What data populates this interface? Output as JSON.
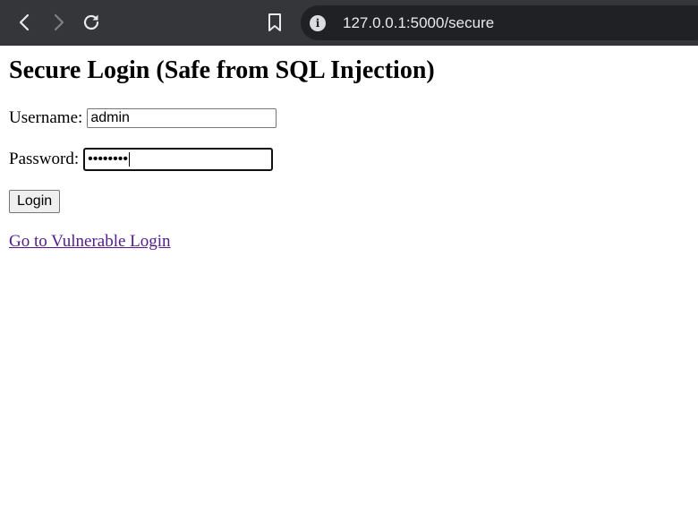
{
  "browser": {
    "url": "127.0.0.1:5000/secure",
    "colors": {
      "toolbar_bg": "#35363a",
      "omnibox_bg": "#202124",
      "icon": "#e8eaed",
      "icon_disabled": "#7f8084"
    },
    "icons": {
      "back": "back-arrow-icon",
      "forward": "forward-arrow-icon",
      "reload": "reload-icon",
      "bookmark": "bookmark-icon",
      "site_info": "info-icon"
    }
  },
  "page": {
    "title": "Secure Login (Safe from SQL Injection)",
    "form": {
      "username_label": "Username:",
      "username_value": "admin",
      "password_label": "Password:",
      "password_masked": "••••••••",
      "submit_label": "Login"
    },
    "link_text": "Go to Vulnerable Login",
    "colors": {
      "link_visited": "#551a8b"
    }
  }
}
